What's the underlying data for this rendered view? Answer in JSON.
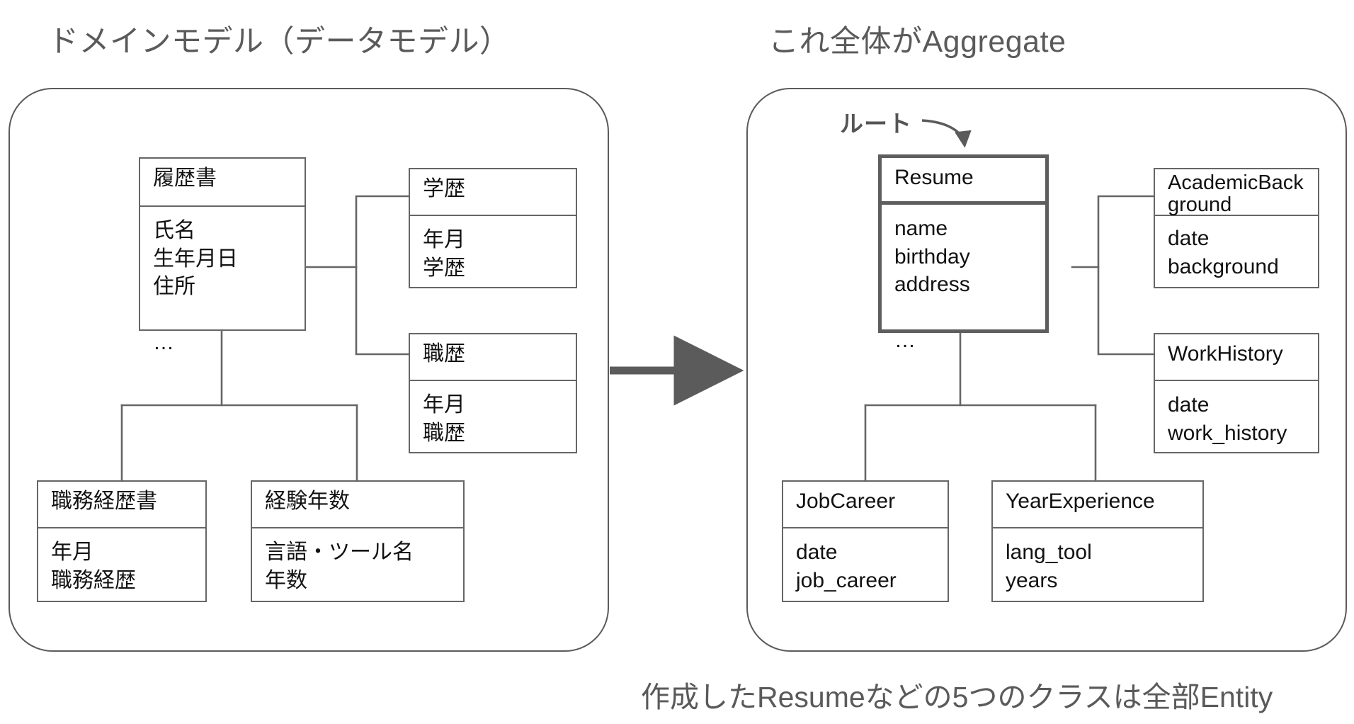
{
  "panels": {
    "left": {
      "title": "ドメインモデル（データモデル）",
      "boxes": [
        {
          "key": "rirekisho",
          "name": "履歴書",
          "attributes": "氏名\n生年月日\n住所\n\n…"
        },
        {
          "key": "gakureki",
          "name": "学歴",
          "attributes": "年月\n学歴"
        },
        {
          "key": "shokureki",
          "name": "職歴",
          "attributes": "年月\n職歴"
        },
        {
          "key": "shokumukeirekisho",
          "name": "職務経歴書",
          "attributes": "年月\n職務経歴"
        },
        {
          "key": "keikennensuu",
          "name": "経験年数",
          "attributes": "言語・ツール名\n年数"
        }
      ]
    },
    "right": {
      "title": "これ全体がAggregate",
      "root_label": "ルート",
      "boxes": [
        {
          "key": "resume",
          "name": "Resume",
          "attributes": "name\nbirthday\naddress\n\n…",
          "is_root": true
        },
        {
          "key": "academic",
          "name": "AcademicBack\nground",
          "attributes": "date\nbackground",
          "is_root": false
        },
        {
          "key": "workhistory",
          "name": "WorkHistory",
          "attributes": "date\nwork_history",
          "is_root": false
        },
        {
          "key": "jobcareer",
          "name": "JobCareer",
          "attributes": "date\njob_career",
          "is_root": false
        },
        {
          "key": "yearexperience",
          "name": "YearExperience",
          "attributes": "lang_tool\nyears",
          "is_root": false
        }
      ]
    }
  },
  "caption": "作成したResumeなどの5つのクラスは全部Entity",
  "colors": {
    "text": "#5a5a5a",
    "box_text": "#121212",
    "box_border": "#666666",
    "root_border": "#5e5e5e",
    "container_border": "#5b5b5b",
    "connector": "#666666",
    "arrow": "#5b5b5b",
    "background": "#ffffff"
  }
}
